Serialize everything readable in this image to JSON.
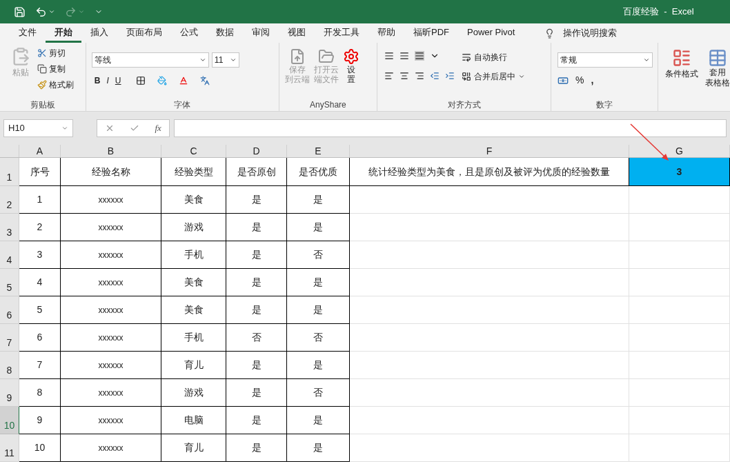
{
  "window": {
    "title": "百度经验  -  Excel"
  },
  "tabs": [
    {
      "label": "文件",
      "selected": false
    },
    {
      "label": "开始",
      "selected": true
    },
    {
      "label": "插入",
      "selected": false
    },
    {
      "label": "页面布局",
      "selected": false
    },
    {
      "label": "公式",
      "selected": false
    },
    {
      "label": "数据",
      "selected": false
    },
    {
      "label": "审阅",
      "selected": false
    },
    {
      "label": "视图",
      "selected": false
    },
    {
      "label": "开发工具",
      "selected": false
    },
    {
      "label": "帮助",
      "selected": false
    },
    {
      "label": "福昕PDF",
      "selected": false
    },
    {
      "label": "Power Pivot",
      "selected": false
    }
  ],
  "tell_me": "操作说明搜索",
  "ribbon": {
    "clipboard": {
      "paste": "粘贴",
      "cut": "剪切",
      "copy": "复制",
      "format_painter": "格式刷",
      "label": "剪贴板"
    },
    "font": {
      "name": "等线",
      "size": "11",
      "bold": "B",
      "italic": "I",
      "underline": "U",
      "label": "字体"
    },
    "anyshare": {
      "save_cloud": [
        "保存",
        "到云端"
      ],
      "open_cloud": [
        "打开云",
        "端文件"
      ],
      "settings": [
        "设",
        "置"
      ],
      "label": "AnyShare"
    },
    "alignment": {
      "wrap": "自动换行",
      "merge": "合并后居中",
      "label": "对齐方式"
    },
    "number": {
      "format": "常规",
      "percent": "%",
      "comma": ",",
      "label": "数字"
    },
    "styles": {
      "conditional": "条件格式",
      "table_format": [
        "套用",
        "表格格"
      ]
    }
  },
  "formula_bar": {
    "name_box": "H10",
    "function_label": "fx"
  },
  "columns": [
    "A",
    "B",
    "C",
    "D",
    "E",
    "F",
    "G"
  ],
  "rows": [
    {
      "header": "1",
      "selected": false,
      "g_filled": true,
      "cells": [
        "序号",
        "经验名称",
        "经验类型",
        "是否原创",
        "是否优质",
        "统计经验类型为美食，且是原创及被评为优质的经验数量",
        "3"
      ]
    },
    {
      "header": "2",
      "selected": false,
      "g_filled": false,
      "cells": [
        "1",
        "xxxxxx",
        "美食",
        "是",
        "是",
        "",
        ""
      ]
    },
    {
      "header": "3",
      "selected": false,
      "g_filled": false,
      "cells": [
        "2",
        "xxxxxx",
        "游戏",
        "是",
        "是",
        "",
        ""
      ]
    },
    {
      "header": "4",
      "selected": false,
      "g_filled": false,
      "cells": [
        "3",
        "xxxxxx",
        "手机",
        "是",
        "否",
        "",
        ""
      ]
    },
    {
      "header": "5",
      "selected": false,
      "g_filled": false,
      "cells": [
        "4",
        "xxxxxx",
        "美食",
        "是",
        "是",
        "",
        ""
      ]
    },
    {
      "header": "6",
      "selected": false,
      "g_filled": false,
      "cells": [
        "5",
        "xxxxxx",
        "美食",
        "是",
        "是",
        "",
        ""
      ]
    },
    {
      "header": "7",
      "selected": false,
      "g_filled": false,
      "cells": [
        "6",
        "xxxxxx",
        "手机",
        "否",
        "否",
        "",
        ""
      ]
    },
    {
      "header": "8",
      "selected": false,
      "g_filled": false,
      "cells": [
        "7",
        "xxxxxx",
        "育儿",
        "是",
        "是",
        "",
        ""
      ]
    },
    {
      "header": "9",
      "selected": false,
      "g_filled": false,
      "cells": [
        "8",
        "xxxxxx",
        "游戏",
        "是",
        "否",
        "",
        ""
      ]
    },
    {
      "header": "10",
      "selected": true,
      "g_filled": false,
      "cells": [
        "9",
        "xxxxxx",
        "电脑",
        "是",
        "是",
        "",
        ""
      ]
    },
    {
      "header": "11",
      "selected": false,
      "g_filled": false,
      "cells": [
        "10",
        "xxxxxx",
        "育儿",
        "是",
        "是",
        "",
        ""
      ]
    }
  ]
}
